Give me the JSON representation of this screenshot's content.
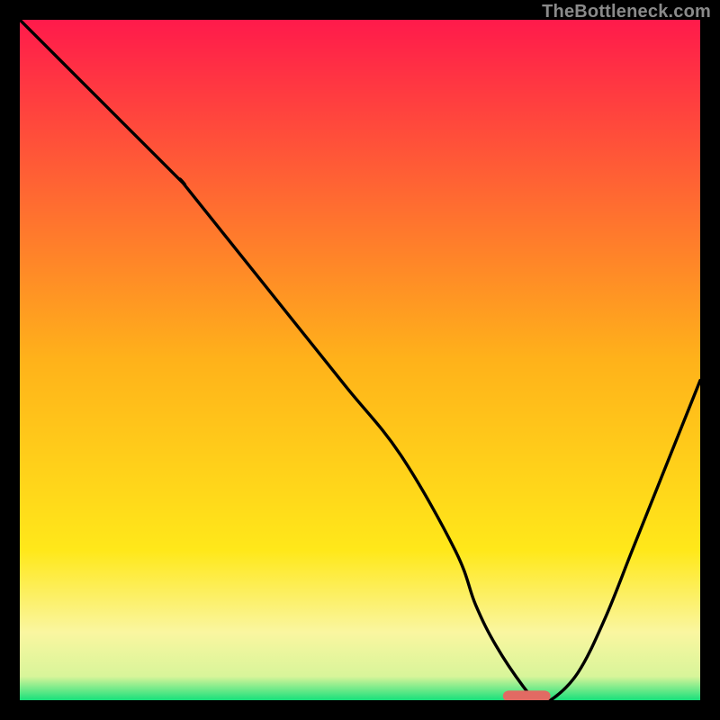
{
  "watermark": "TheBottleneck.com",
  "chart_data": {
    "type": "line",
    "title": "",
    "xlabel": "",
    "ylabel": "",
    "xlim": [
      0,
      100
    ],
    "ylim": [
      0,
      100
    ],
    "grid": false,
    "legend": false,
    "background_gradient": {
      "stops": [
        {
          "pos": 0.0,
          "color": "#ff1a4b"
        },
        {
          "pos": 0.5,
          "color": "#ffb21a"
        },
        {
          "pos": 0.78,
          "color": "#ffe81a"
        },
        {
          "pos": 0.9,
          "color": "#faf6a0"
        },
        {
          "pos": 0.965,
          "color": "#d8f59a"
        },
        {
          "pos": 1.0,
          "color": "#18e07b"
        }
      ]
    },
    "series": [
      {
        "name": "bottleneck-curve",
        "color": "#000000",
        "width": 3,
        "x": [
          0,
          6,
          12,
          18,
          24,
          24,
          32,
          40,
          48,
          56,
          64,
          67,
          70,
          74,
          76,
          78,
          82,
          86,
          90,
          94,
          98,
          100
        ],
        "y": [
          100,
          94,
          88,
          82,
          76,
          76,
          66,
          56,
          46,
          36,
          22,
          14,
          8,
          2,
          0,
          0,
          4,
          12,
          22,
          32,
          42,
          47
        ]
      }
    ],
    "marker": {
      "name": "optimal-range",
      "color": "#e26a63",
      "x_center": 74.5,
      "y": 0.6,
      "width": 7,
      "height": 1.6,
      "rx": 0.9
    }
  }
}
